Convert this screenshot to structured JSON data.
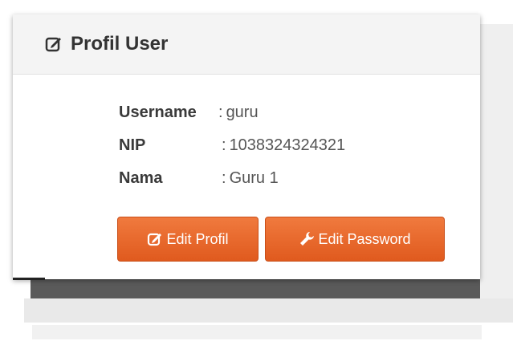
{
  "panel": {
    "title": "Profil User",
    "title_icon": "edit-icon"
  },
  "profile": {
    "username": {
      "label": "Username",
      "separator": ":",
      "value": "guru"
    },
    "nip": {
      "label": "NIP",
      "separator": ":",
      "value": "1038324324321"
    },
    "nama": {
      "label": "Nama",
      "separator": ":",
      "value": "Guru 1"
    }
  },
  "buttons": {
    "edit_profil": {
      "label": "Edit Profil",
      "icon": "edit-icon"
    },
    "edit_password": {
      "label": "Edit Password",
      "icon": "wrench-icon"
    }
  },
  "colors": {
    "button_primary": "#e8642a",
    "header_bg": "#f4f4f4"
  }
}
